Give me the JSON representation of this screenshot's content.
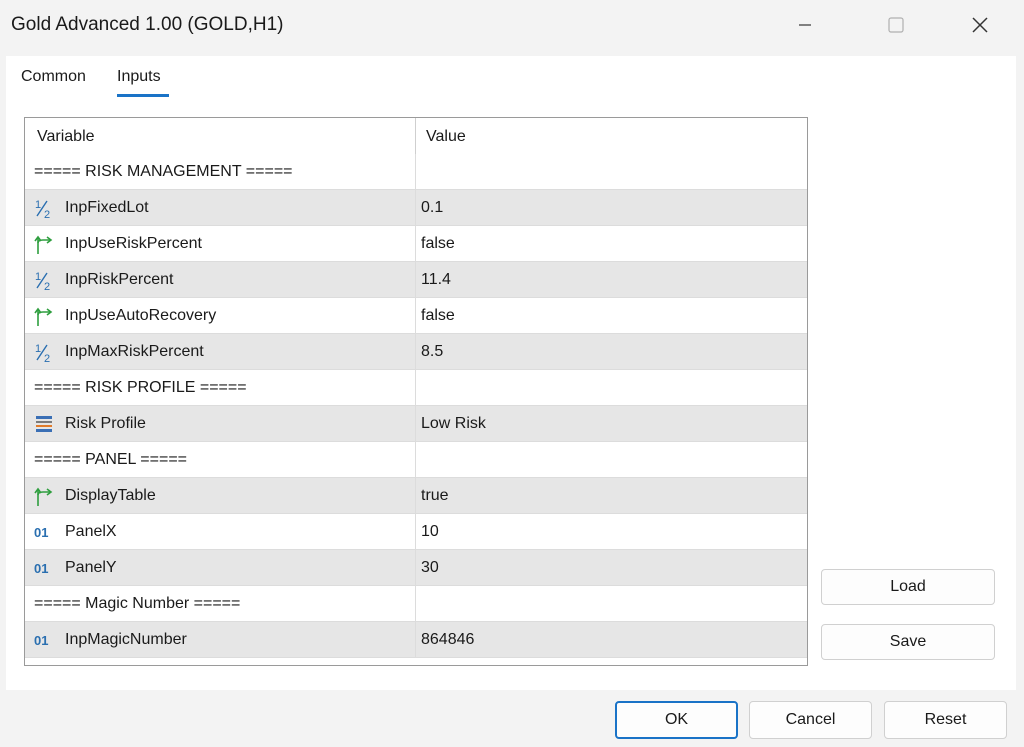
{
  "window": {
    "title": "Gold Advanced 1.00 (GOLD,H1)"
  },
  "tabs": [
    {
      "label": "Common"
    },
    {
      "label": "Inputs"
    }
  ],
  "grid": {
    "header": {
      "variable": "Variable",
      "value": "Value"
    },
    "rows": [
      {
        "type": "section",
        "variable": "===== RISK MANAGEMENT =====",
        "value": ""
      },
      {
        "type": "double",
        "icon": "fraction-icon",
        "variable": "InpFixedLot",
        "value": "0.1"
      },
      {
        "type": "bool",
        "icon": "boolean-arrow-icon",
        "variable": "InpUseRiskPercent",
        "value": "false"
      },
      {
        "type": "double",
        "icon": "fraction-icon",
        "variable": "InpRiskPercent",
        "value": "11.4"
      },
      {
        "type": "bool",
        "icon": "boolean-arrow-icon",
        "variable": "InpUseAutoRecovery",
        "value": "false"
      },
      {
        "type": "double",
        "icon": "fraction-icon",
        "variable": "InpMaxRiskPercent",
        "value": "8.5"
      },
      {
        "type": "section",
        "variable": "===== RISK PROFILE =====",
        "value": ""
      },
      {
        "type": "enum",
        "icon": "enum-list-icon",
        "variable": "Risk Profile",
        "value": "Low Risk"
      },
      {
        "type": "section",
        "variable": "===== PANEL =====",
        "value": ""
      },
      {
        "type": "bool",
        "icon": "boolean-arrow-icon",
        "variable": "DisplayTable",
        "value": "true"
      },
      {
        "type": "int",
        "icon": "integer-icon",
        "variable": "PanelX",
        "value": "10"
      },
      {
        "type": "int",
        "icon": "integer-icon",
        "variable": "PanelY",
        "value": "30"
      },
      {
        "type": "section",
        "variable": "===== Magic Number =====",
        "value": ""
      },
      {
        "type": "int",
        "icon": "integer-icon",
        "variable": "InpMagicNumber",
        "value": "864846"
      }
    ]
  },
  "side_buttons": {
    "load": "Load",
    "save": "Save"
  },
  "footer_buttons": {
    "ok": "OK",
    "cancel": "Cancel",
    "reset": "Reset"
  },
  "colors": {
    "accent": "#1a73c7",
    "fraction": "#2a6fb0",
    "boolean": "#2e9e3e",
    "integer": "#2a6fb0"
  }
}
